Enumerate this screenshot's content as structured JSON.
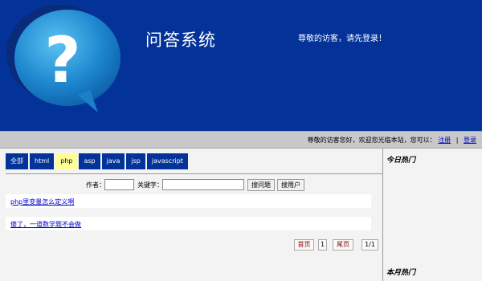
{
  "header": {
    "title": "问答系统",
    "greeting": "尊敬的访客，请先登录！",
    "colors": {
      "bg": "#033399",
      "bubble": "#1e90d6"
    }
  },
  "welcome_bar": {
    "text": "尊敬的访客您好，欢迎您光临本站，您可以：",
    "register": "注册",
    "separator": "|",
    "login": "登录"
  },
  "tabs": [
    {
      "label": "全部",
      "active": false
    },
    {
      "label": "html",
      "active": false
    },
    {
      "label": "php",
      "active": true
    },
    {
      "label": "asp",
      "active": false
    },
    {
      "label": "java",
      "active": false
    },
    {
      "label": "jsp",
      "active": false
    },
    {
      "label": "javascript",
      "active": false
    }
  ],
  "search": {
    "author_label": "作者：",
    "author_value": "",
    "keyword_label": "关键字：",
    "keyword_value": "",
    "search_questions": "搜问题",
    "search_users": "搜用户"
  },
  "questions": [
    {
      "title": "php里变量怎么定义啊"
    },
    {
      "title": "傻了，一道数学题不会做"
    }
  ],
  "pagination": {
    "first": "首页",
    "current": "1",
    "last": "尾页",
    "page_of": "1/1"
  },
  "sidebar": {
    "today_hot": "今日热门",
    "month_hot": "本月热门"
  }
}
